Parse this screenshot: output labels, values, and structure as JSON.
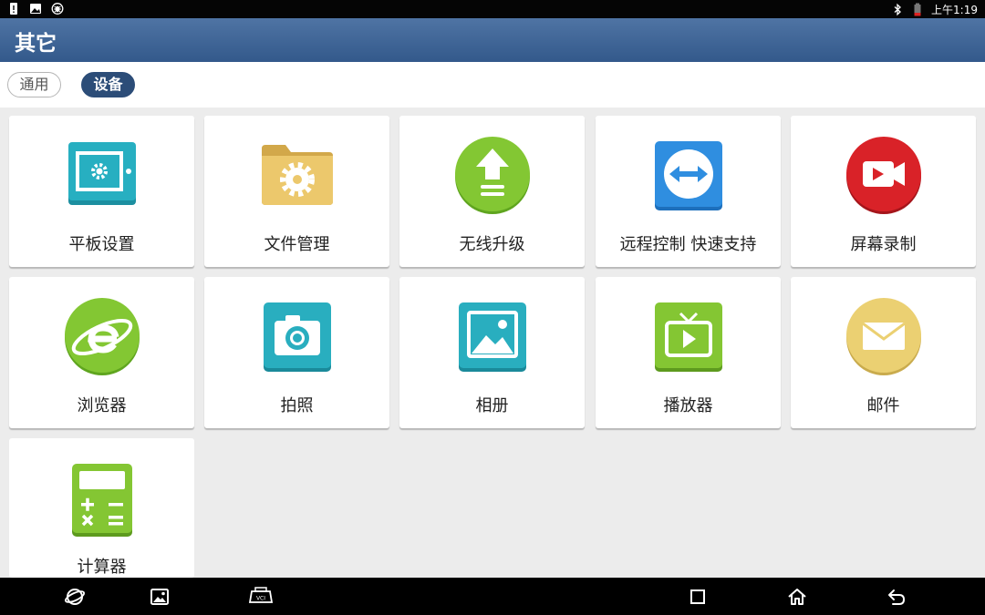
{
  "status_bar": {
    "time": "上午1:19",
    "left_icons": [
      "sim-alert-icon",
      "image-icon",
      "bug-icon"
    ],
    "right_icons": [
      "bluetooth-icon",
      "battery-icon"
    ]
  },
  "header": {
    "title": "其它"
  },
  "tabs": [
    {
      "label": "通用",
      "active": false
    },
    {
      "label": "设备",
      "active": true
    }
  ],
  "apps": [
    {
      "label": "平板设置",
      "icon": "tablet-settings-icon"
    },
    {
      "label": "文件管理",
      "icon": "folder-gear-icon"
    },
    {
      "label": "无线升级",
      "icon": "upload-arrow-icon"
    },
    {
      "label": "远程控制 快速支持",
      "icon": "teamviewer-arrows-icon"
    },
    {
      "label": "屏幕录制",
      "icon": "video-camera-icon"
    },
    {
      "label": "浏览器",
      "icon": "browser-e-icon"
    },
    {
      "label": "拍照",
      "icon": "camera-icon"
    },
    {
      "label": "相册",
      "icon": "gallery-icon"
    },
    {
      "label": "播放器",
      "icon": "tv-play-icon"
    },
    {
      "label": "邮件",
      "icon": "envelope-icon"
    },
    {
      "label": "计算器",
      "icon": "calculator-icon"
    }
  ],
  "nav_bar": {
    "left_icons": [
      "browser-orbit-icon",
      "gallery-small-icon",
      "vci-connector-icon"
    ],
    "right_icons": [
      "recents-square-icon",
      "home-icon",
      "back-icon"
    ]
  },
  "colors": {
    "header": "#3c6294",
    "active_tab": "#2c4d78",
    "teal": "#1fa7b8",
    "green": "#7cc22e",
    "red": "#d61f26",
    "folder": "#e6c466",
    "envelope": "#e9cf6e"
  }
}
